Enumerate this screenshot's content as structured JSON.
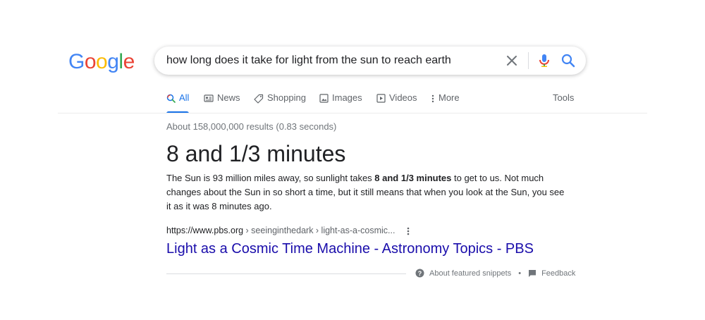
{
  "logo": {
    "letters": [
      "G",
      "o",
      "o",
      "g",
      "l",
      "e"
    ]
  },
  "search": {
    "query": "how long does it take for light from the sun to reach earth",
    "icons": [
      "close-icon",
      "mic-icon",
      "search-icon"
    ]
  },
  "tabs": [
    {
      "label": "All",
      "icon": "search-icon",
      "active": true
    },
    {
      "label": "News",
      "icon": "newspaper-icon"
    },
    {
      "label": "Shopping",
      "icon": "tag-icon"
    },
    {
      "label": "Images",
      "icon": "image-icon"
    },
    {
      "label": "Videos",
      "icon": "play-icon"
    },
    {
      "label": "More",
      "icon": "more-vert-icon"
    }
  ],
  "tools_label": "Tools",
  "stats": "About 158,000,000 results (0.83 seconds)",
  "featured": {
    "answer": "8 and 1/3 minutes",
    "snippet_before": "The Sun is 93 million miles away, so sunlight takes ",
    "snippet_bold": "8 and 1/3 minutes",
    "snippet_after": " to get to us. Not much changes about the Sun in so short a time, but it still means that when you look at the Sun, you see it as it was 8 minutes ago.",
    "cite_domain": "https://www.pbs.org",
    "cite_path": " › seeinginthedark › light-as-a-cosmic...",
    "title": "Light as a Cosmic Time Machine - Astronomy Topics - PBS"
  },
  "footer": {
    "about_label": "About featured snippets",
    "separator": "•",
    "feedback_label": "Feedback"
  },
  "colors": {
    "google_blue": "#4285F4",
    "google_red": "#EA4335",
    "google_yellow": "#FBBC05",
    "google_green": "#34A853",
    "link": "#1a0dab",
    "active_tab": "#1a73e8"
  }
}
